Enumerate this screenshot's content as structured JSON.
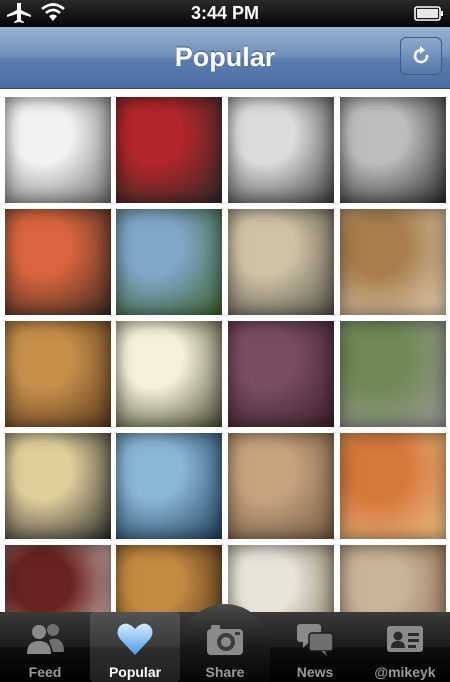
{
  "status_bar": {
    "time": "3:44 PM"
  },
  "nav": {
    "title": "Popular"
  },
  "tabs": [
    {
      "label": "Feed",
      "icon": "people-icon"
    },
    {
      "label": "Popular",
      "icon": "heart-icon"
    },
    {
      "label": "Share",
      "icon": "camera-icon"
    },
    {
      "label": "News",
      "icon": "speech-bubbles-icon"
    },
    {
      "label": "@mikeyk",
      "icon": "profile-card-icon"
    }
  ],
  "photos": [
    {
      "id": "cat-sleeping",
      "tones": [
        "#f2f2f2",
        "#6e6e6e"
      ]
    },
    {
      "id": "magazine-prophet",
      "tones": [
        "#b3262a",
        "#2b2b2b"
      ]
    },
    {
      "id": "car-mirror",
      "tones": [
        "#dcdcdc",
        "#3c3c3c"
      ]
    },
    {
      "id": "man-in-hallway",
      "tones": [
        "#bdbdbd",
        "#2a2a2a"
      ]
    },
    {
      "id": "sushi-plate",
      "tones": [
        "#d8653d",
        "#3a2a22"
      ]
    },
    {
      "id": "mountain-vineyard",
      "tones": [
        "#7fa8c9",
        "#3d5f2a"
      ]
    },
    {
      "id": "coffee-grinder",
      "tones": [
        "#cfc3a6",
        "#575049"
      ]
    },
    {
      "id": "cat-on-floor",
      "tones": [
        "#a97e4d",
        "#e5d6bb"
      ]
    },
    {
      "id": "beer-mugs",
      "tones": [
        "#c6904a",
        "#5a3a1e"
      ]
    },
    {
      "id": "crystal-cluster",
      "tones": [
        "#f5f2d9",
        "#4d4a33"
      ]
    },
    {
      "id": "dog-portrait",
      "tones": [
        "#7a4c62",
        "#3d1f30"
      ]
    },
    {
      "id": "couple-outdoors",
      "tones": [
        "#6f8a54",
        "#9c9c9c"
      ]
    },
    {
      "id": "selfie-face",
      "tones": [
        "#e0cf9b",
        "#2c2c2c"
      ]
    },
    {
      "id": "stadium-light",
      "tones": [
        "#89b7d8",
        "#1e3f5c"
      ]
    },
    {
      "id": "man-eating-pizza",
      "tones": [
        "#c8a27c",
        "#6f5a45"
      ]
    },
    {
      "id": "pasta-dish",
      "tones": [
        "#d6773b",
        "#f0c48a"
      ]
    },
    {
      "id": "red-box",
      "tones": [
        "#6a2222",
        "#e8e2d6"
      ]
    },
    {
      "id": "beer-glass",
      "tones": [
        "#c38a42",
        "#3d2815"
      ]
    },
    {
      "id": "food-platter",
      "tones": [
        "#e9e4d8",
        "#7d6e52"
      ]
    },
    {
      "id": "soup-bowl",
      "tones": [
        "#c7b49a",
        "#8d6a4a"
      ]
    }
  ]
}
